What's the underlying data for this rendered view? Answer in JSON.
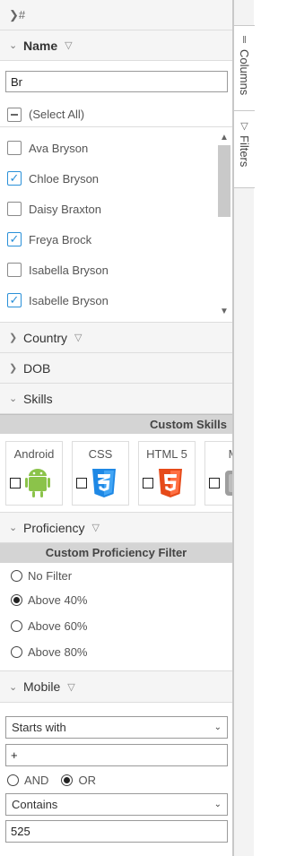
{
  "columns_group": {
    "label": "#"
  },
  "name_filter": {
    "title": "Name",
    "search_value": "Br",
    "select_all_label": "(Select All)",
    "items": [
      {
        "label": "Ava Bryson",
        "checked": false
      },
      {
        "label": "Chloe Bryson",
        "checked": true
      },
      {
        "label": "Daisy Braxton",
        "checked": false
      },
      {
        "label": "Freya Brock",
        "checked": true
      },
      {
        "label": "Isabella Bryson",
        "checked": false
      },
      {
        "label": "Isabelle Bryson",
        "checked": true
      }
    ]
  },
  "country": {
    "title": "Country"
  },
  "dob": {
    "title": "DOB"
  },
  "skills": {
    "title": "Skills",
    "custom_title": "Custom Skills",
    "cards": [
      {
        "name": "Android",
        "icon": "android-icon",
        "color": "#8bc34a"
      },
      {
        "name": "CSS",
        "icon": "css3-icon",
        "color": "#1e88e5"
      },
      {
        "name": "HTML 5",
        "icon": "html5-icon",
        "color": "#e64a19"
      },
      {
        "name": "M",
        "icon": "mac-icon",
        "color": "#9e9e9e"
      }
    ]
  },
  "proficiency": {
    "title": "Proficiency",
    "custom_title": "Custom Proficiency Filter",
    "options": [
      {
        "label": "No Filter",
        "selected": false
      },
      {
        "label": "Above 40%",
        "selected": true
      },
      {
        "label": "Above 60%",
        "selected": false
      },
      {
        "label": "Above 80%",
        "selected": false
      }
    ]
  },
  "mobile": {
    "title": "Mobile",
    "condition1": "Starts with",
    "value1": "+",
    "and_label": "AND",
    "or_label": "OR",
    "join": "OR",
    "condition2": "Contains",
    "value2": "525"
  },
  "sidebar": {
    "columns_tab": "Columns",
    "filters_tab": "Filters"
  },
  "colors": {
    "accent": "#2a90d8",
    "header_bg": "#f5f5f5",
    "custom_bar": "#d4d4d4"
  }
}
